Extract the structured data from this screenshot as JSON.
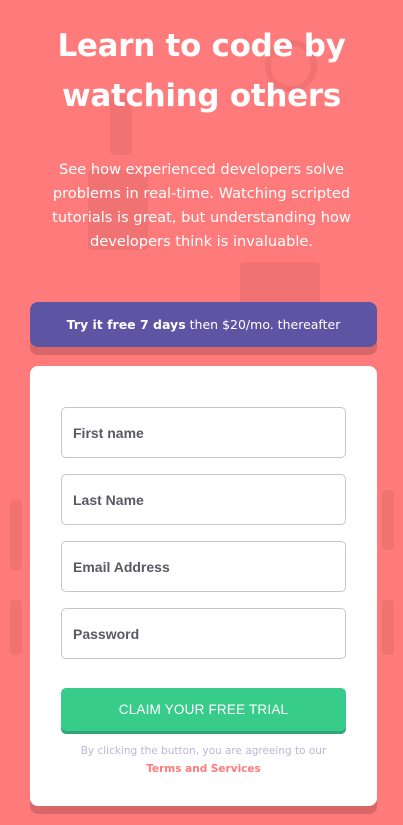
{
  "hero": {
    "headline": "Learn to code by watching others",
    "intro": "See how experienced developers solve problems in real-time. Watching scripted tutorials is great, but understanding how developers think is invaluable."
  },
  "banner": {
    "bold_text": "Try it free 7 days",
    "rest_text": "then $20/mo. thereafter"
  },
  "form": {
    "first_name_placeholder": "First name",
    "last_name_placeholder": "Last Name",
    "email_placeholder": "Email Address",
    "password_placeholder": "Password",
    "submit_label": "Claim your free trial",
    "terms_prefix": "By clicking the button, you are agreeing to our",
    "terms_link": "Terms and Services"
  },
  "colors": {
    "background": "#ff7a7a",
    "banner": "#5e54a4",
    "accent_green": "#38cc8b",
    "field_border": "#c8c3d6",
    "terms_text": "#bab7d4"
  }
}
